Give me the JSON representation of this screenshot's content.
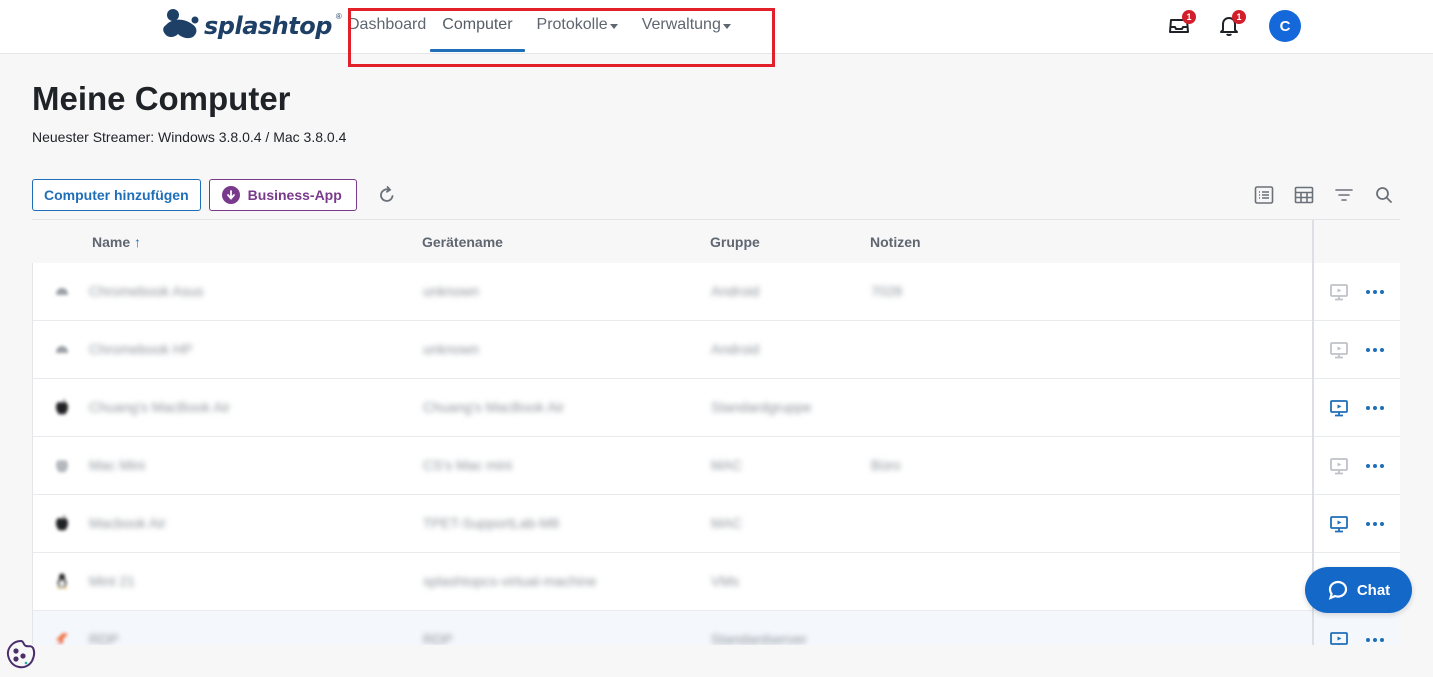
{
  "brand": {
    "name": "splashtop",
    "reg": "®",
    "color": "#1e3f66"
  },
  "nav": {
    "items": [
      {
        "label": "Dashboard",
        "active": false,
        "dropdown": false
      },
      {
        "label": "Computer",
        "active": true,
        "dropdown": false
      },
      {
        "label": "Protokolle",
        "active": false,
        "dropdown": true
      },
      {
        "label": "Verwaltung",
        "active": false,
        "dropdown": true
      }
    ]
  },
  "header": {
    "inbox_icon": "inbox-icon",
    "inbox_badge": "1",
    "bell_icon": "bell-icon",
    "bell_badge": "1",
    "avatar_initial": "C"
  },
  "page": {
    "title": "Meine Computer",
    "subtitle": "Neuester Streamer: Windows 3.8.0.4 / Mac 3.8.0.4"
  },
  "toolbar": {
    "add_label": "Computer hinzufügen",
    "business_label": "Business-App",
    "refresh_icon": "refresh-icon",
    "view_icons": [
      "list-view-icon",
      "grid-view-icon",
      "filter-icon",
      "search-icon"
    ]
  },
  "table": {
    "columns": {
      "name": "Name",
      "name_sort": "↑",
      "device": "Gerätename",
      "group": "Gruppe",
      "notes": "Notizen"
    },
    "rows": [
      {
        "os": "android",
        "name": "Chromebook Asus",
        "device": "unknown",
        "group": "Android",
        "notes": "7028",
        "online": false,
        "highlight": false
      },
      {
        "os": "android",
        "name": "Chromebook HP",
        "device": "unknown",
        "group": "Android",
        "notes": "",
        "online": false,
        "highlight": false
      },
      {
        "os": "apple",
        "name": "Chuang's MacBook Air",
        "device": "Chuang's MacBook Air",
        "group": "Standardgruppe",
        "notes": "",
        "online": true,
        "highlight": false
      },
      {
        "os": "apple-grey",
        "name": "Mac Mini",
        "device": "CS's Mac mini",
        "group": "MAC",
        "notes": "Büro",
        "online": false,
        "highlight": false
      },
      {
        "os": "apple",
        "name": "Macbook Air",
        "device": "TPET-SupportLab-M8",
        "group": "MAC",
        "notes": "",
        "online": true,
        "highlight": false
      },
      {
        "os": "linux",
        "name": "Mint 21",
        "device": "splashtopcs-virtual-machine",
        "group": "VMs",
        "notes": "",
        "online": true,
        "highlight": false
      },
      {
        "os": "rdp",
        "name": "RDP",
        "device": "RDP",
        "group": "Standardserver",
        "notes": "",
        "online": true,
        "highlight": true
      }
    ]
  },
  "chat": {
    "label": "Chat"
  },
  "colors": {
    "primary": "#1f6fb8",
    "purple": "#7a3a8c",
    "badge": "#d1202b",
    "avatar": "#1468d9",
    "annotation": "#e2202a"
  }
}
